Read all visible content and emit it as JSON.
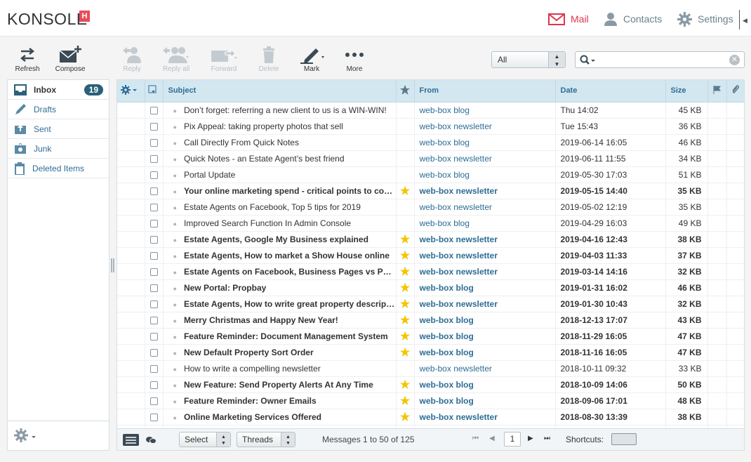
{
  "app": {
    "logo": "KONSOLE",
    "logo_badge": "H"
  },
  "topnav": {
    "mail": "Mail",
    "contacts": "Contacts",
    "settings": "Settings"
  },
  "toolbar": {
    "refresh": "Refresh",
    "compose": "Compose",
    "reply": "Reply",
    "reply_all": "Reply all",
    "forward": "Forward",
    "delete": "Delete",
    "mark": "Mark",
    "more": "More"
  },
  "filter": {
    "selected": "All"
  },
  "search": {
    "placeholder": ""
  },
  "folders": [
    {
      "label": "Inbox",
      "count": "19",
      "icon": "inbox-icon"
    },
    {
      "label": "Drafts",
      "icon": "pencil-icon"
    },
    {
      "label": "Sent",
      "icon": "sent-icon"
    },
    {
      "label": "Junk",
      "icon": "junk-icon"
    },
    {
      "label": "Deleted Items",
      "icon": "trash-icon"
    }
  ],
  "columns": {
    "subject": "Subject",
    "from": "From",
    "date": "Date",
    "size": "Size"
  },
  "messages": [
    {
      "subject": "Don’t forget: referring a new client to us is a WIN-WIN!",
      "from": "web-box blog",
      "date": "Thu 14:02",
      "size": "45 KB",
      "unread": false,
      "flagged": false
    },
    {
      "subject": "Pix Appeal: taking property photos that sell",
      "from": "web-box newsletter",
      "date": "Tue 15:43",
      "size": "36 KB",
      "unread": false,
      "flagged": false
    },
    {
      "subject": "Call Directly From Quick Notes",
      "from": "web-box blog",
      "date": "2019-06-14 16:05",
      "size": "46 KB",
      "unread": false,
      "flagged": false
    },
    {
      "subject": "Quick Notes - an Estate Agent’s best friend",
      "from": "web-box newsletter",
      "date": "2019-06-11 11:55",
      "size": "34 KB",
      "unread": false,
      "flagged": false
    },
    {
      "subject": "Portal Update",
      "from": "web-box blog",
      "date": "2019-05-30 17:03",
      "size": "51 KB",
      "unread": false,
      "flagged": false
    },
    {
      "subject": "Your online marketing spend - critical points to consider",
      "from": "web-box newsletter",
      "date": "2019-05-15 14:40",
      "size": "35 KB",
      "unread": true,
      "flagged": true
    },
    {
      "subject": "Estate Agents on Facebook, Top 5 tips for 2019",
      "from": "web-box newsletter",
      "date": "2019-05-02 12:19",
      "size": "35 KB",
      "unread": false,
      "flagged": false
    },
    {
      "subject": "Improved Search Function In Admin Console",
      "from": "web-box blog",
      "date": "2019-04-29 16:03",
      "size": "49 KB",
      "unread": false,
      "flagged": false
    },
    {
      "subject": "Estate Agents, Google My Business explained",
      "from": "web-box newsletter",
      "date": "2019-04-16 12:43",
      "size": "38 KB",
      "unread": true,
      "flagged": true
    },
    {
      "subject": "Estate Agents, How to market a Show House online",
      "from": "web-box newsletter",
      "date": "2019-04-03 11:33",
      "size": "37 KB",
      "unread": true,
      "flagged": true
    },
    {
      "subject": "Estate Agents on Facebook, Business Pages vs Personal Profiles",
      "from": "web-box newsletter",
      "date": "2019-03-14 14:16",
      "size": "32 KB",
      "unread": true,
      "flagged": true
    },
    {
      "subject": "New Portal: Propbay",
      "from": "web-box blog",
      "date": "2019-01-31 16:02",
      "size": "46 KB",
      "unread": true,
      "flagged": true
    },
    {
      "subject": "Estate Agents, How to write great property descriptions",
      "from": "web-box newsletter",
      "date": "2019-01-30 10:43",
      "size": "32 KB",
      "unread": true,
      "flagged": true
    },
    {
      "subject": "Merry Christmas and Happy New Year!",
      "from": "web-box blog",
      "date": "2018-12-13 17:07",
      "size": "43 KB",
      "unread": true,
      "flagged": true
    },
    {
      "subject": "Feature Reminder: Document Management System",
      "from": "web-box blog",
      "date": "2018-11-29 16:05",
      "size": "47 KB",
      "unread": true,
      "flagged": true
    },
    {
      "subject": "New Default Property Sort Order",
      "from": "web-box blog",
      "date": "2018-11-16 16:05",
      "size": "47 KB",
      "unread": true,
      "flagged": true
    },
    {
      "subject": "How to write a compelling newsletter",
      "from": "web-box newsletter",
      "date": "2018-10-11 09:32",
      "size": "33 KB",
      "unread": false,
      "flagged": false
    },
    {
      "subject": "New Feature: Send Property Alerts At Any Time",
      "from": "web-box blog",
      "date": "2018-10-09 14:06",
      "size": "50 KB",
      "unread": true,
      "flagged": true
    },
    {
      "subject": "Feature Reminder: Owner Emails",
      "from": "web-box blog",
      "date": "2018-09-06 17:01",
      "size": "48 KB",
      "unread": true,
      "flagged": true
    },
    {
      "subject": "Online Marketing Services Offered",
      "from": "web-box newsletter",
      "date": "2018-08-30 13:39",
      "size": "38 KB",
      "unread": true,
      "flagged": true
    },
    {
      "subject": "",
      "from": "",
      "date": "",
      "size": "",
      "unread": false,
      "flagged": false
    }
  ],
  "footer": {
    "select": "Select",
    "threads": "Threads",
    "message_count": "Messages 1 to 50 of 125",
    "page": "1",
    "shortcuts": "Shortcuts:"
  },
  "colors": {
    "accent": "#e0334f",
    "header_bg": "#d3e7f1",
    "link": "#2e6d96",
    "star": "#f2c500",
    "badge": "#2b5f7a"
  }
}
